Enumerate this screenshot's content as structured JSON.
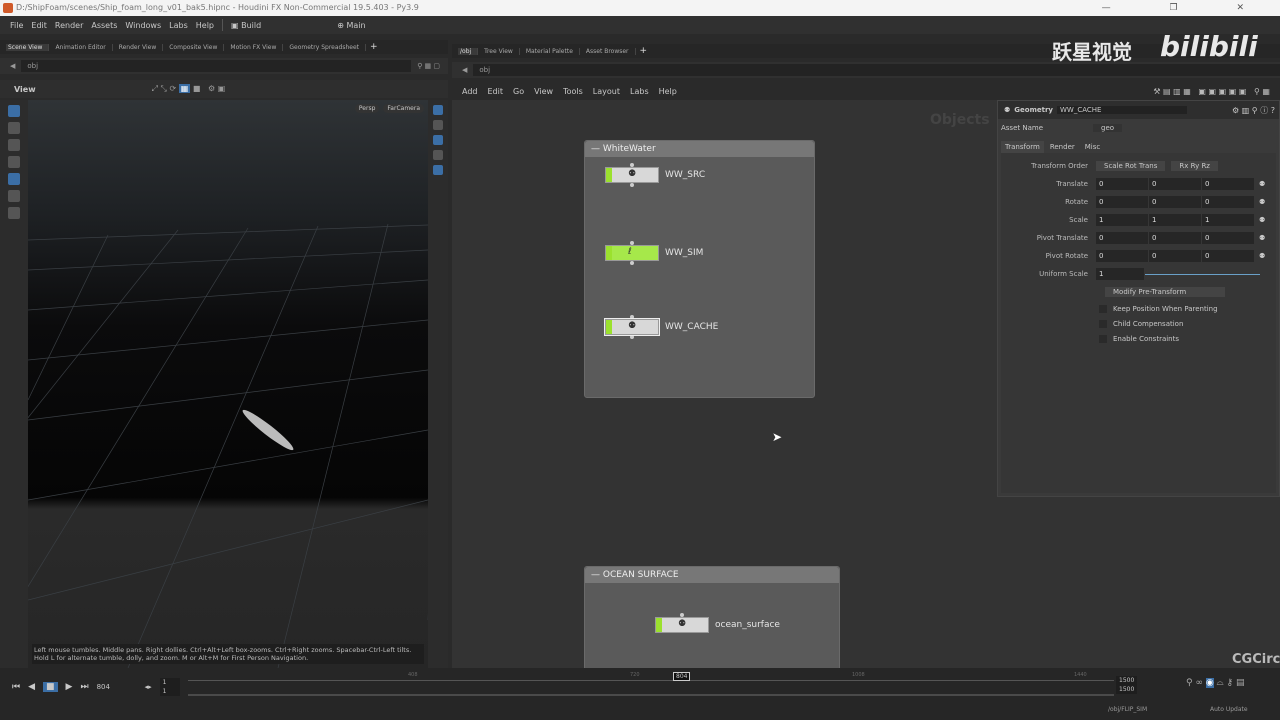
{
  "window": {
    "title": "D:/ShipFoam/scenes/Ship_foam_long_v01_bak5.hipnc - Houdini FX Non-Commercial 19.5.403 - Py3.9"
  },
  "menubar": {
    "items": [
      "File",
      "Edit",
      "Render",
      "Assets",
      "Windows",
      "Labs",
      "Help"
    ],
    "desktop": "Build",
    "context": "Main"
  },
  "left_pane": {
    "tabs": [
      "Scene View",
      "Animation Editor",
      "Render View",
      "Composite View",
      "Motion FX View",
      "Geometry Spreadsheet"
    ],
    "path": "obj",
    "view_label": "View",
    "persp": "Persp",
    "camera": "FarCamera",
    "hint_line1": "Left mouse tumbles. Middle pans. Right dollies. Ctrl+Alt+Left box-zooms. Ctrl+Right zooms. Spacebar-Ctrl-Left tilts.",
    "hint_line2": "Hold L for alternate tumble, dolly, and zoom.    M or Alt+M for First Person Navigation."
  },
  "right_pane": {
    "tabs": [
      "/obj",
      "Tree View",
      "Material Palette",
      "Asset Browser"
    ],
    "path": "obj",
    "menu": [
      "Add",
      "Edit",
      "Go",
      "View",
      "Tools",
      "Layout",
      "Labs",
      "Help"
    ],
    "context_label": "Objects",
    "netboxes": [
      {
        "title": "WhiteWater",
        "nodes": [
          "WW_SRC",
          "WW_SIM",
          "WW_CACHE"
        ]
      },
      {
        "title": "OCEAN SURFACE",
        "nodes": [
          "ocean_surface"
        ]
      }
    ]
  },
  "params": {
    "type": "Geometry",
    "name": "WW_CACHE",
    "asset_name_label": "Asset Name",
    "asset_name": "geo",
    "tabs": [
      "Transform",
      "Render",
      "Misc"
    ],
    "transform_order_label": "Transform Order",
    "transform_order": "Scale Rot Trans",
    "rot_order": "Rx Ry Rz",
    "rows": [
      {
        "label": "Translate",
        "v": [
          "0",
          "0",
          "0"
        ]
      },
      {
        "label": "Rotate",
        "v": [
          "0",
          "0",
          "0"
        ]
      },
      {
        "label": "Scale",
        "v": [
          "1",
          "1",
          "1"
        ]
      },
      {
        "label": "Pivot Translate",
        "v": [
          "0",
          "0",
          "0"
        ]
      },
      {
        "label": "Pivot Rotate",
        "v": [
          "0",
          "0",
          "0"
        ]
      }
    ],
    "uniform_scale_label": "Uniform Scale",
    "uniform_scale": "1",
    "pre_transform": "Modify Pre-Transform",
    "checks": [
      "Keep Position When Parenting",
      "Child Compensation",
      "Enable Constraints"
    ]
  },
  "timeline": {
    "frame": "804",
    "start": "1",
    "start2": "1",
    "end": "1500",
    "end2": "1500",
    "ticks": [
      "408",
      "720",
      "1008",
      "1440"
    ],
    "sim_path": "/obj/FLIP_SIM",
    "update_mode": "Auto Update"
  },
  "watermarks": {
    "top": "跃星视觉",
    "bili": "bilibili",
    "bottom": "CGCirc"
  },
  "colors": {
    "node_flag": "#9be12e",
    "accent": "#3b6ea5"
  }
}
